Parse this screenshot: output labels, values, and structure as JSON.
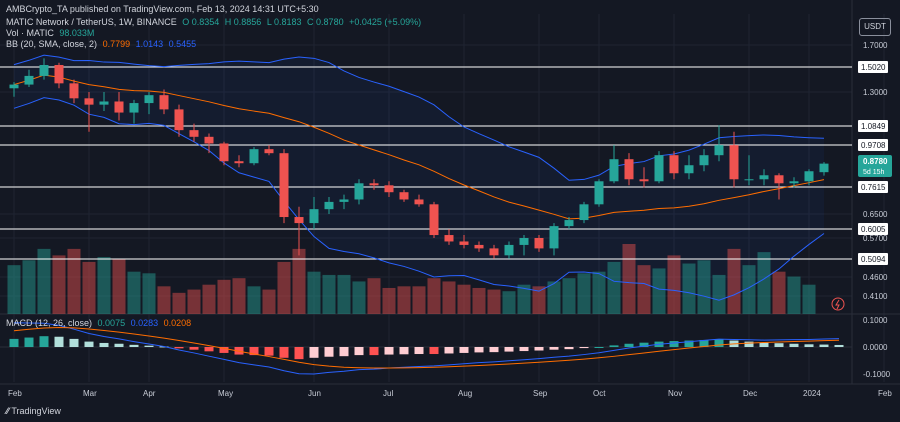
{
  "publisher_line": "AMBCrypto_TA published on TradingView.com, Feb 13, 2024 14:31 UTC+5:30",
  "symbol_line": {
    "name": "MATIC Network / TetherUS, 1W, BINANCE",
    "open": "O 0.8354",
    "high": "H 0.8856",
    "low": "L 0.8183",
    "close": "C 0.8780",
    "change": "+0.0425 (+5.09%)"
  },
  "volume_line": {
    "label": "Vol · MATIC",
    "value": "98.033M"
  },
  "bb_line": {
    "label": "BB (20, SMA, close, 2)",
    "basis": "0.7799",
    "upper": "1.0143",
    "lower": "0.5455"
  },
  "macd_line": {
    "label": "MACD (12, 26, close)",
    "hist": "0.0075",
    "macd": "0.0283",
    "signal": "0.0208"
  },
  "currency_button": "USDT",
  "logo_text": "TradingView",
  "price_tag": {
    "value": "0.8780",
    "countdown": "5d 15h"
  },
  "colors": {
    "up": "#26a69a",
    "down": "#ef5350",
    "bb_band": "#2962ff",
    "bb_basis": "#ff6d00",
    "macd": "#2962ff",
    "signal": "#ff6d00",
    "background": "#141823"
  },
  "chart_data": {
    "type": "candlestick",
    "price_axis_ticks": [
      1.7,
      1.3,
      0.97,
      0.65,
      0.57,
      0.46,
      0.41
    ],
    "price_axis_tick_labels": [
      "1.7000",
      "1.3000",
      "0.9708",
      "0.6500",
      "0.5700",
      "0.4600",
      "0.4100"
    ],
    "levels": [
      {
        "value": 1.502,
        "label": "1.5020"
      },
      {
        "value": 1.0849,
        "label": "1.0849"
      },
      {
        "value": 0.9708,
        "label": "0.9708"
      },
      {
        "value": 0.7615,
        "label": "0.7615"
      },
      {
        "value": 0.6005,
        "label": "0.6005"
      },
      {
        "value": 0.5094,
        "label": "0.5094"
      }
    ],
    "macd_axis_ticks": [
      0.1,
      0.0,
      -0.1
    ],
    "macd_axis_tick_labels": [
      "0.1000",
      "0.0000",
      "-0.1000"
    ],
    "x_labels": [
      {
        "text": "Feb",
        "index": 0
      },
      {
        "text": "Mar",
        "index": 5
      },
      {
        "text": "Apr",
        "index": 9
      },
      {
        "text": "May",
        "index": 14
      },
      {
        "text": "Jun",
        "index": 20
      },
      {
        "text": "Jul",
        "index": 25
      },
      {
        "text": "Aug",
        "index": 30
      },
      {
        "text": "Sep",
        "index": 35
      },
      {
        "text": "Oct",
        "index": 39
      },
      {
        "text": "Nov",
        "index": 44
      },
      {
        "text": "Dec",
        "index": 49
      },
      {
        "text": "2024",
        "index": 53
      },
      {
        "text": "Feb",
        "index": 58
      }
    ],
    "candles": [
      [
        1.33,
        1.38,
        1.27,
        1.36
      ],
      [
        1.36,
        1.48,
        1.34,
        1.43
      ],
      [
        1.43,
        1.58,
        1.4,
        1.52
      ],
      [
        1.52,
        1.54,
        1.33,
        1.37
      ],
      [
        1.37,
        1.4,
        1.23,
        1.26
      ],
      [
        1.26,
        1.3,
        1.05,
        1.22
      ],
      [
        1.22,
        1.3,
        1.18,
        1.24
      ],
      [
        1.24,
        1.3,
        1.12,
        1.17
      ],
      [
        1.17,
        1.25,
        1.1,
        1.23
      ],
      [
        1.23,
        1.3,
        1.16,
        1.28
      ],
      [
        1.28,
        1.32,
        1.16,
        1.19
      ],
      [
        1.19,
        1.22,
        1.02,
        1.06
      ],
      [
        1.06,
        1.1,
        0.99,
        1.02
      ],
      [
        1.02,
        1.04,
        0.93,
        0.98
      ],
      [
        0.98,
        0.99,
        0.87,
        0.89
      ],
      [
        0.89,
        0.92,
        0.86,
        0.88
      ],
      [
        0.88,
        0.96,
        0.87,
        0.95
      ],
      [
        0.95,
        0.97,
        0.92,
        0.93
      ],
      [
        0.93,
        0.95,
        0.62,
        0.64
      ],
      [
        0.64,
        0.68,
        0.52,
        0.62
      ],
      [
        0.62,
        0.72,
        0.6,
        0.67
      ],
      [
        0.67,
        0.72,
        0.65,
        0.7
      ],
      [
        0.7,
        0.73,
        0.67,
        0.71
      ],
      [
        0.71,
        0.8,
        0.69,
        0.78
      ],
      [
        0.78,
        0.8,
        0.75,
        0.77
      ],
      [
        0.77,
        0.79,
        0.72,
        0.74
      ],
      [
        0.74,
        0.75,
        0.7,
        0.71
      ],
      [
        0.71,
        0.73,
        0.68,
        0.69
      ],
      [
        0.69,
        0.7,
        0.57,
        0.58
      ],
      [
        0.58,
        0.6,
        0.55,
        0.56
      ],
      [
        0.56,
        0.58,
        0.54,
        0.55
      ],
      [
        0.55,
        0.56,
        0.53,
        0.54
      ],
      [
        0.54,
        0.55,
        0.51,
        0.52
      ],
      [
        0.52,
        0.56,
        0.51,
        0.55
      ],
      [
        0.55,
        0.58,
        0.52,
        0.57
      ],
      [
        0.57,
        0.58,
        0.53,
        0.54
      ],
      [
        0.54,
        0.62,
        0.52,
        0.61
      ],
      [
        0.61,
        0.64,
        0.6,
        0.63
      ],
      [
        0.63,
        0.7,
        0.62,
        0.69
      ],
      [
        0.69,
        0.8,
        0.68,
        0.79
      ],
      [
        0.79,
        0.97,
        0.78,
        0.9
      ],
      [
        0.9,
        0.93,
        0.77,
        0.8
      ],
      [
        0.8,
        0.86,
        0.76,
        0.79
      ],
      [
        0.79,
        0.94,
        0.78,
        0.92
      ],
      [
        0.92,
        0.94,
        0.8,
        0.83
      ],
      [
        0.83,
        0.92,
        0.8,
        0.87
      ],
      [
        0.87,
        0.95,
        0.84,
        0.92
      ],
      [
        0.92,
        1.09,
        0.89,
        0.97
      ],
      [
        0.97,
        1.05,
        0.76,
        0.8
      ],
      [
        0.8,
        0.92,
        0.77,
        0.8
      ],
      [
        0.8,
        0.85,
        0.77,
        0.82
      ],
      [
        0.82,
        0.83,
        0.71,
        0.78
      ],
      [
        0.78,
        0.81,
        0.76,
        0.79
      ],
      [
        0.79,
        0.85,
        0.77,
        0.84
      ],
      [
        0.8354,
        0.8856,
        0.8183,
        0.878
      ]
    ],
    "volume_values": [
      30,
      33,
      40,
      36,
      40,
      32,
      35,
      34,
      26,
      25,
      17,
      13,
      15,
      18,
      21,
      22,
      17,
      15,
      32,
      40,
      26,
      24,
      24,
      20,
      22,
      16,
      17,
      17,
      22,
      20,
      18,
      16,
      15,
      14,
      18,
      17,
      20,
      22,
      25,
      26,
      32,
      43,
      30,
      28,
      36,
      31,
      33,
      24,
      40,
      30,
      38,
      26,
      23,
      18
    ],
    "macd_hist": [
      0.03,
      0.035,
      0.04,
      0.038,
      0.03,
      0.02,
      0.015,
      0.012,
      0.008,
      0.005,
      0.002,
      -0.005,
      -0.01,
      -0.016,
      -0.022,
      -0.028,
      -0.03,
      -0.032,
      -0.04,
      -0.045,
      -0.04,
      -0.036,
      -0.034,
      -0.03,
      -0.03,
      -0.028,
      -0.027,
      -0.026,
      -0.026,
      -0.024,
      -0.022,
      -0.02,
      -0.019,
      -0.017,
      -0.015,
      -0.013,
      -0.01,
      -0.008,
      -0.004,
      0.0,
      0.006,
      0.012,
      0.016,
      0.02,
      0.022,
      0.024,
      0.026,
      0.028,
      0.024,
      0.02,
      0.016,
      0.014,
      0.012,
      0.01,
      0.009,
      0.0075
    ]
  }
}
